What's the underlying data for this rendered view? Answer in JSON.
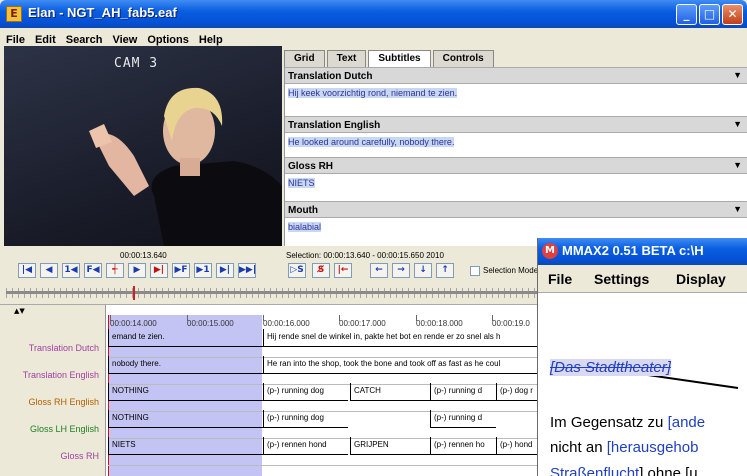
{
  "window": {
    "title": "Elan - NGT_AH_fab5.eaf",
    "min": "_",
    "max": "□",
    "close": "✕"
  },
  "menu": [
    "File",
    "Edit",
    "Search",
    "View",
    "Options",
    "Help"
  ],
  "video": {
    "label": "CAM 3"
  },
  "tabs": [
    "Grid",
    "Text",
    "Subtitles",
    "Controls"
  ],
  "tiers_panel": [
    {
      "name": "Translation Dutch",
      "value": "Hij keek voorzichtig rond, niemand te zien."
    },
    {
      "name": "Translation English",
      "value": "He looked around carefully, nobody there."
    },
    {
      "name": "Gloss RH",
      "value": "NIETS"
    },
    {
      "name": "Mouth",
      "value": "bialabial"
    }
  ],
  "controls": {
    "current_time": "00:00:13.640",
    "selection": "Selection: 00:00:13.640 - 00:00:15.650  2010",
    "selection_mode": "Selection Mode"
  },
  "timeline": {
    "ticks": [
      "00:00:14.000",
      "00:00:15.000",
      "00:00:16.000",
      "00:00:17.000",
      "00:00:18.000",
      "00:00:19.0"
    ],
    "tier_names": [
      "Translation Dutch",
      "Translation English",
      "Gloss RH English",
      "Gloss LH English",
      "Gloss RH"
    ],
    "tier_colors": [
      "#a040a0",
      "#a040a0",
      "#b06000",
      "#208020",
      "#a040a0"
    ],
    "rows": [
      [
        "emand te zien.",
        "Hij rende snel de winkel in, pakte het bot en rende er zo snel als h"
      ],
      [
        "nobody there.",
        "He ran into the shop, took the bone and took off as fast as he coul"
      ],
      [
        "NOTHING",
        "(p-) running dog",
        "CATCH",
        "(p-) running d",
        "(p-) dog r"
      ],
      [
        "NOTHING",
        "(p-) running dog",
        "(p-) running d"
      ],
      [
        "NIETS",
        "(p-) rennen hond",
        "GRIJPEN",
        "(p-) rennen ho",
        "(p-) hond"
      ]
    ]
  },
  "mmax": {
    "title": "MMAX2 0.51 BETA c:\\H",
    "menu": [
      "File",
      "Settings",
      "Display"
    ],
    "line1": "[Das Stadttheater]",
    "line2a": "Im Gegensatz zu ",
    "line2b": "[ande",
    "line3a": "nicht an ",
    "line3b": "[herausgehob",
    "line4a": "Straßenflucht",
    "line4b": "] ohne [u"
  },
  "colors": {
    "selection": "#c4c4f4",
    "cursor": "#d01010",
    "titlebar": "#0a5ee0"
  }
}
